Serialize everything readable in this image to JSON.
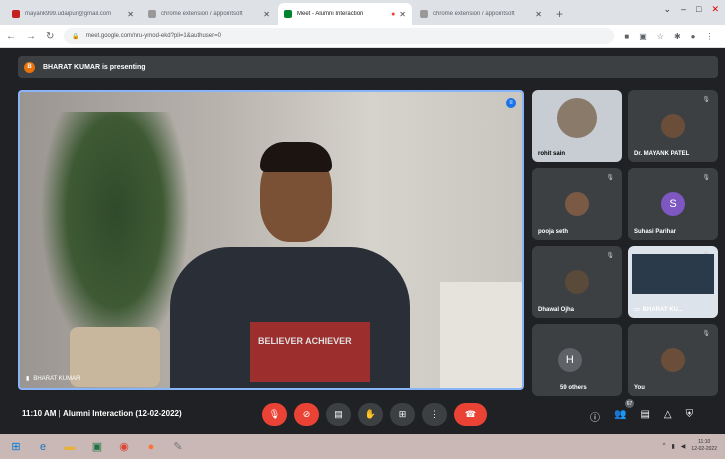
{
  "browser": {
    "tabs": [
      {
        "title": "mayank999.udaipur@gmail.com",
        "favicon_color": "#c5221f",
        "active": false
      },
      {
        "title": "chrome extension / appointsoft",
        "favicon_color": "#777",
        "active": false
      },
      {
        "title": "Meet - Alumni Interaction",
        "favicon_color": "#00832d",
        "active": true
      },
      {
        "title": "chrome extension / appointsoft",
        "favicon_color": "#777",
        "active": false
      }
    ],
    "new_tab": "+",
    "url": "meet.google.com/nru-ymod-ekd?pli=1&authuser=0"
  },
  "meet": {
    "presenting_initial": "B",
    "presenting_text": "BHARAT KUMAR is presenting",
    "main_name": "BHARAT KUMAR",
    "shirt_text": "BELIEVER ACHIEVER",
    "participants": [
      {
        "name": "rohit sain",
        "initial": "",
        "color": "#8a7a6a"
      },
      {
        "name": "Dr. MAYANK PATEL",
        "initial": "",
        "color": "#6b4e3a"
      },
      {
        "name": "pooja seth",
        "initial": "",
        "color": "#7a5a45"
      },
      {
        "name": "Suhasi Parihar",
        "initial": "S",
        "color": "#7e57c2"
      },
      {
        "name": "Dhawal Ojha",
        "initial": "",
        "color": "#5a4a3a"
      },
      {
        "name": "BHARAT KU...",
        "initial": "",
        "color": "#dde3ea"
      },
      {
        "name": "59 others",
        "initial": "H",
        "color": "#5f6368"
      },
      {
        "name": "You",
        "initial": "",
        "color": "#6b4e3a"
      }
    ],
    "time": "11:10 AM",
    "meeting_name": "Alumni Interaction (12-02-2022)",
    "participant_count": "67"
  },
  "taskbar": {
    "time": "11:10",
    "date": "12-02-2022"
  }
}
